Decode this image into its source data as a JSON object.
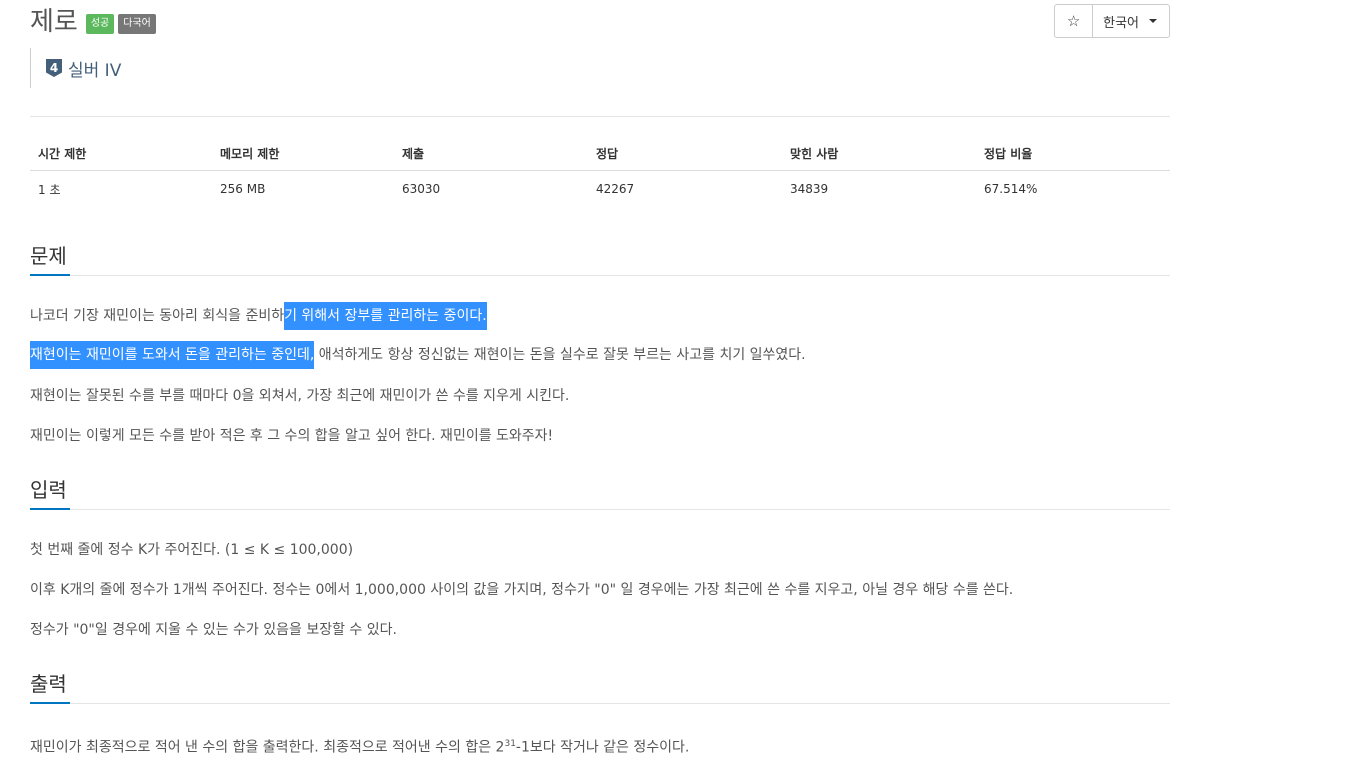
{
  "problem": {
    "title": "제로",
    "badge_success": "성공",
    "badge_lang": "다국어",
    "tier_number": "4",
    "tier_label": "실버 IV"
  },
  "toolbar": {
    "star_icon": "☆",
    "language": "한국어"
  },
  "stats": {
    "headers": [
      "시간 제한",
      "메모리 제한",
      "제출",
      "정답",
      "맞힌 사람",
      "정답 비율"
    ],
    "values": [
      "1 초",
      "256 MB",
      "63030",
      "42267",
      "34839",
      "67.514%"
    ]
  },
  "sections": {
    "problem_heading": "문제",
    "p1_plain": "나코더 기장 재민이는 동아리 회식을 준비하",
    "p1_hl": "기 위해서 장부를 관리하는 중이다.",
    "p2_hl": "재현이는 재민이를 도와서 돈을 관리하는 중인데,",
    "p2_plain": " 애석하게도 항상 정신없는 재현이는 돈을 실수로 잘못 부르는 사고를 치기 일쑤였다.",
    "p3": "재현이는 잘못된 수를 부를 때마다 0을 외쳐서, 가장 최근에 재민이가 쓴 수를 지우게 시킨다.",
    "p4": "재민이는 이렇게 모든 수를 받아 적은 후 그 수의 합을 알고 싶어 한다. 재민이를 도와주자!",
    "input_heading": "입력",
    "i1": "첫 번째 줄에 정수 K가 주어진다. (1 ≤ K ≤ 100,000)",
    "i2": "이후 K개의 줄에 정수가 1개씩 주어진다. 정수는 0에서 1,000,000 사이의 값을 가지며, 정수가 \"0\" 일 경우에는 가장 최근에 쓴 수를 지우고, 아닐 경우 해당 수를 쓴다.",
    "i3": "정수가 \"0\"일 경우에 지울 수 있는 수가 있음을 보장할 수 있다.",
    "output_heading": "출력",
    "o1_a": "재민이가 최종적으로 적어 낸 수의 합을 출력한다. 최종적으로 적어낸 수의 합은 2",
    "o1_sup": "31",
    "o1_b": "-1보다 작거나 같은 정수이다."
  }
}
